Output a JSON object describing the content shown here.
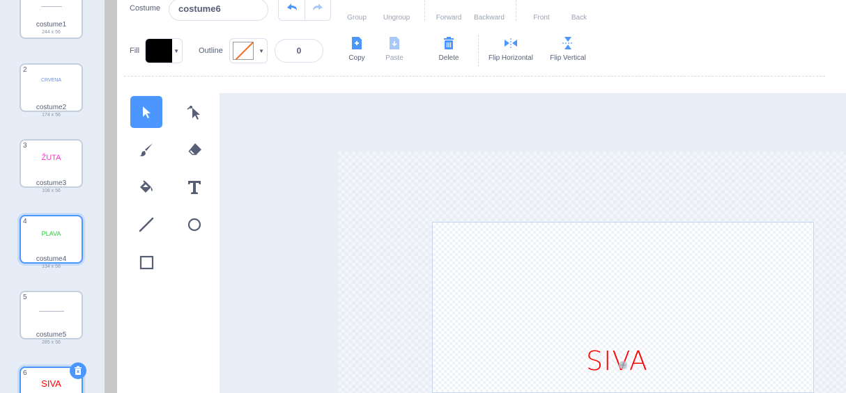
{
  "costumes": [
    {
      "num": "",
      "preview": "",
      "name": "costume1",
      "size": "244 x 56",
      "preview_color": "#9aa3b5"
    },
    {
      "num": "2",
      "preview": "CRVENA",
      "name": "costume2",
      "size": "174 x 56",
      "preview_color": "#6f8fd8"
    },
    {
      "num": "3",
      "preview": "ŽUTA",
      "name": "costume3",
      "size": "108 x 56",
      "preview_color": "#ff33cc"
    },
    {
      "num": "4",
      "preview": "PLAVA",
      "name": "costume4",
      "size": "134 x 56",
      "preview_color": "#2ecc40"
    },
    {
      "num": "5",
      "preview": "",
      "name": "costume5",
      "size": "285 x 56",
      "preview_color": "#9aa3b5"
    },
    {
      "num": "6",
      "preview": "SIVA",
      "name": "",
      "size": "",
      "preview_color": "#ff0000"
    }
  ],
  "toolbar": {
    "costume_label": "Costume",
    "costume_name": "costume6",
    "group": "Group",
    "ungroup": "Ungroup",
    "forward": "Forward",
    "backward": "Backward",
    "front": "Front",
    "back": "Back",
    "fill_label": "Fill",
    "outline_label": "Outline",
    "stroke_width": "0",
    "copy": "Copy",
    "paste": "Paste",
    "delete": "Delete",
    "flip_horizontal": "Flip Horizontal",
    "flip_vertical": "Flip Vertical"
  },
  "colors": {
    "accent": "#4c97ff",
    "fill": "#000000",
    "outline_none": "#f26a22",
    "delete_red": "#4c97ff"
  },
  "canvas": {
    "text": "SIVA",
    "text_color": "#ff0000"
  }
}
